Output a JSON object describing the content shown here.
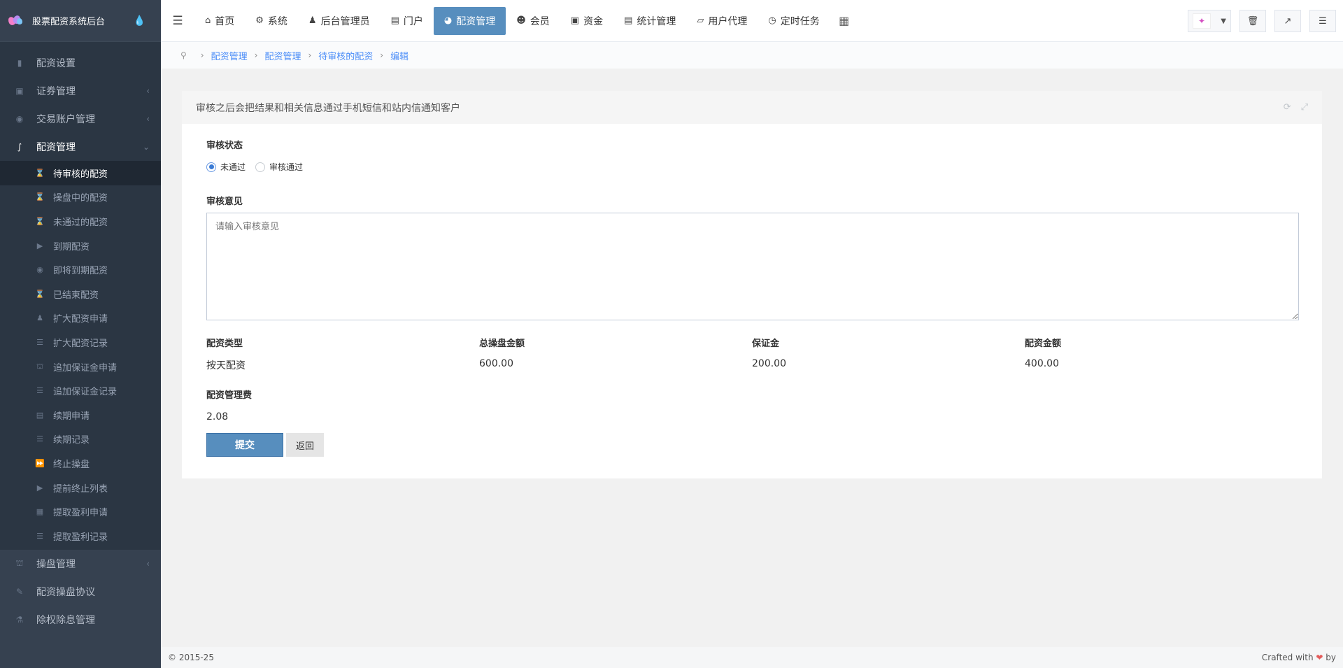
{
  "brand": {
    "title": "股票配资系统后台"
  },
  "sidebar": {
    "items": [
      {
        "label": "配资设置",
        "icon": "signal-icon"
      },
      {
        "label": "证券管理",
        "icon": "area-chart-icon",
        "arrow": "‹"
      },
      {
        "label": "交易账户管理",
        "icon": "user-circle-icon",
        "arrow": "‹"
      },
      {
        "label": "配资管理",
        "icon": "thermometer-icon",
        "arrow": "⌄"
      }
    ],
    "submenu": [
      {
        "label": "待审核的配资",
        "icon": "hourglass-icon"
      },
      {
        "label": "操盘中的配资",
        "icon": "hourglass-icon"
      },
      {
        "label": "未通过的配资",
        "icon": "hourglass-icon"
      },
      {
        "label": "到期配资",
        "icon": "step-forward-icon"
      },
      {
        "label": "即将到期配资",
        "icon": "camera-icon"
      },
      {
        "label": "已结束配资",
        "icon": "hourglass-icon"
      },
      {
        "label": "扩大配资申请",
        "icon": "chess-icon"
      },
      {
        "label": "扩大配资记录",
        "icon": "list-icon"
      },
      {
        "label": "追加保证金申请",
        "icon": "bank-icon"
      },
      {
        "label": "追加保证金记录",
        "icon": "list-ul-icon"
      },
      {
        "label": "续期申请",
        "icon": "file-icon"
      },
      {
        "label": "续期记录",
        "icon": "list-icon"
      },
      {
        "label": "终止操盘",
        "icon": "fast-forward-icon"
      },
      {
        "label": "提前终止列表",
        "icon": "step-forward-icon"
      },
      {
        "label": "提取盈利申请",
        "icon": "film-icon"
      },
      {
        "label": "提取盈利记录",
        "icon": "list-ul-icon"
      }
    ],
    "bottom": [
      {
        "label": "操盘管理",
        "icon": "bank-icon",
        "arrow": "‹"
      },
      {
        "label": "配资操盘协议",
        "icon": "pencil-icon"
      },
      {
        "label": "除权除息管理",
        "icon": "flask-icon"
      }
    ]
  },
  "topnav": {
    "items": [
      {
        "label": "首页",
        "icon": "home-icon"
      },
      {
        "label": "系统",
        "icon": "gear-icon"
      },
      {
        "label": "后台管理员",
        "icon": "user-icon"
      },
      {
        "label": "门户",
        "icon": "newspaper-icon"
      },
      {
        "label": "配资管理",
        "icon": "pie-chart-icon"
      },
      {
        "label": "会员",
        "icon": "users-icon"
      },
      {
        "label": "资金",
        "icon": "money-icon"
      },
      {
        "label": "统计管理",
        "icon": "bar-chart-icon"
      },
      {
        "label": "用户代理",
        "icon": "sitemap-icon"
      },
      {
        "label": "定时任务",
        "icon": "clock-icon"
      }
    ]
  },
  "breadcrumb": [
    "配资管理",
    "配资管理",
    "待审核的配资",
    "编辑"
  ],
  "panel": {
    "title": "审核之后会把结果和相关信息通过手机短信和站内信通知客户",
    "status_label": "审核状态",
    "radio_rejected": "未通过",
    "radio_approved": "审核通过",
    "opinion_label": "审核意见",
    "opinion_placeholder": "请输入审核意见",
    "info": [
      {
        "label": "配资类型",
        "value": "按天配资"
      },
      {
        "label": "总操盘金额",
        "value": "600.00"
      },
      {
        "label": "保证金",
        "value": "200.00"
      },
      {
        "label": "配资金额",
        "value": "400.00"
      }
    ],
    "fee_label": "配资管理费",
    "fee_value": "2.08",
    "submit_label": "提交",
    "back_label": "返回"
  },
  "footer": {
    "copyright": "© 2015-25",
    "crafted_prefix": "Crafted with",
    "crafted_suffix": "by"
  },
  "colors": {
    "accent": "#578ebe",
    "sidebar": "#2b3643",
    "link": "#4b8df8"
  }
}
